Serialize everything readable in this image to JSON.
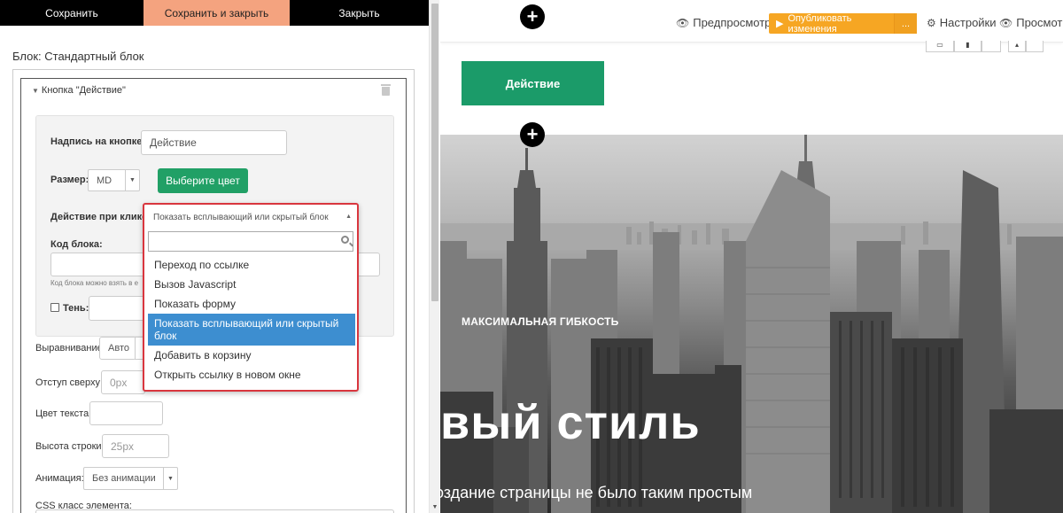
{
  "editor": {
    "toolbar": {
      "save": "Сохранить",
      "save_close": "Сохранить и закрыть",
      "close": "Закрыть"
    },
    "block_title": "Блок: Стандартный блок",
    "accordion_title": "Кнопка \"Действие\"",
    "form": {
      "caption_label": "Надпись на кнопке:",
      "caption_value": "Действие",
      "size_label": "Размер:",
      "size_value": "MD",
      "color_button": "Выберите цвет",
      "click_action_label": "Действие при клике:",
      "block_code_label": "Код блока:",
      "block_code_hint": "Код блока можно взять в е",
      "shadow_label": "Тень:",
      "align_label": "Выравнивание",
      "align_value": "Авто",
      "margin_top_label": "Отступ сверху:",
      "margin_top_placeholder": "0px",
      "text_color_label": "Цвет текста:",
      "line_height_label": "Высота строки:",
      "line_height_placeholder": "25px",
      "animation_label": "Анимация:",
      "animation_value": "Без анимации",
      "css_class_label": "CSS класс элемента:"
    },
    "dropdown": {
      "selected": "Показать всплывающий или скрытый блок",
      "search_value": "",
      "options": [
        "Переход по ссылке",
        "Вызов Javascript",
        "Показать форму",
        "Показать всплывающий или скрытый блок",
        "Добавить в корзину",
        "Открыть ссылку в новом окне"
      ],
      "active_index": 3
    }
  },
  "preview": {
    "toolbar": {
      "preview_link": "Предпросмотр",
      "publish": "Опубликовать изменения",
      "publish_more": "...",
      "settings": "Настройки",
      "view": "Просмотр"
    },
    "action_button": "Действие",
    "hero": {
      "kicker": "МАКСИМАЛЬНАЯ ГИБКОСТЬ",
      "title": "вый стиль",
      "subtitle": "оздание страницы не было таким простым"
    }
  },
  "colors": {
    "accent_orange": "#f6a623",
    "save_close_bg": "#f4a37f",
    "green": "#21a066",
    "highlight_blue": "#3d8ed0",
    "dropdown_border": "#d9363e"
  }
}
